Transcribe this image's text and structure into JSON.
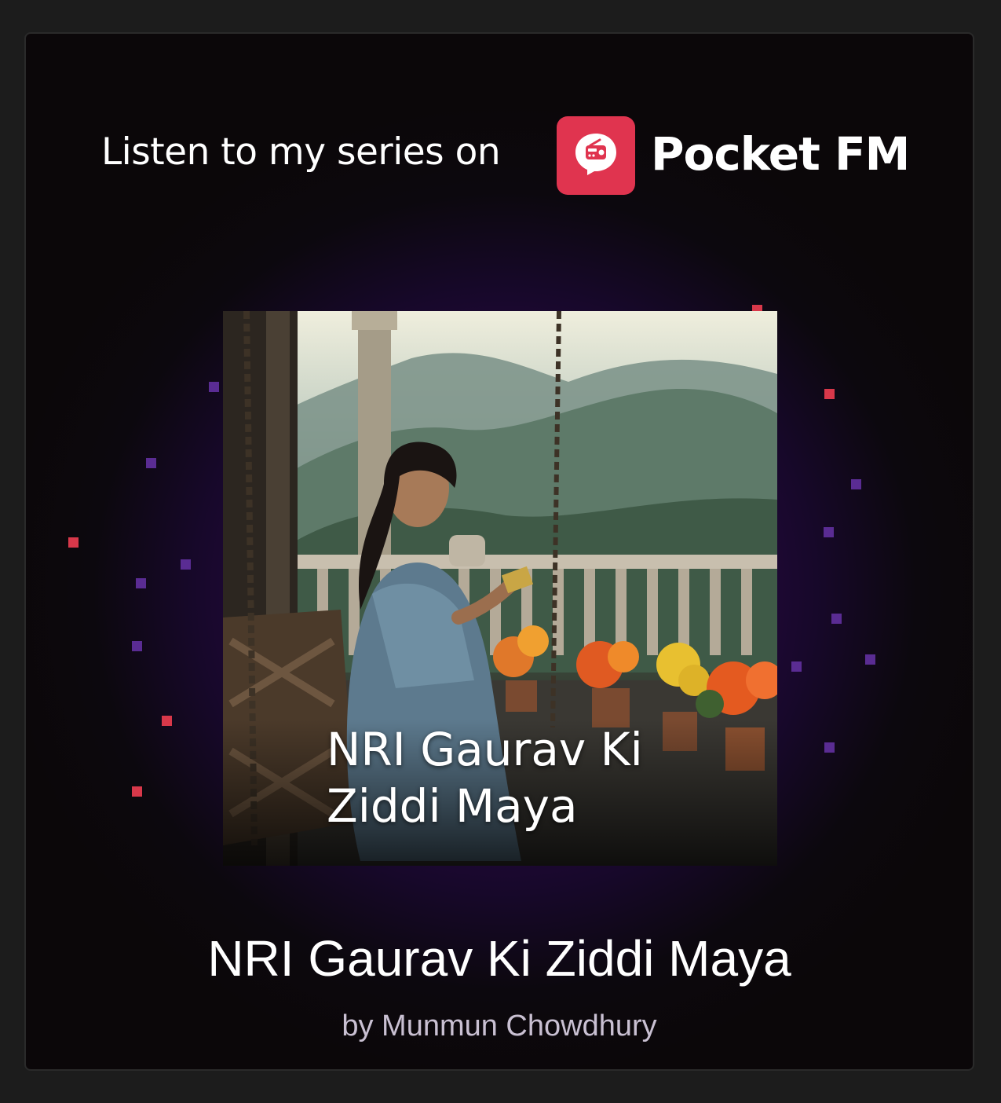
{
  "header": {
    "text": "Listen to my series on",
    "brand": "Pocket FM",
    "logo_icon": "radio-speech-bubble-icon",
    "brand_color": "#e0344f"
  },
  "cover": {
    "title": "NRI Gaurav Ki Ziddi Maya"
  },
  "series": {
    "title": "NRI Gaurav Ki Ziddi Maya",
    "author": "by Munmun Chowdhury"
  },
  "colors": {
    "background": "#0b0709",
    "glow": "#3b0e5c",
    "pixel_red": "#d8384a",
    "pixel_purple": "#5a2c93"
  }
}
